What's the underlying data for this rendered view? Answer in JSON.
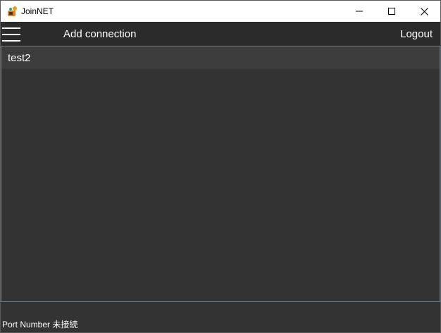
{
  "window": {
    "title": "JoinNET"
  },
  "toolbar": {
    "add_connection_label": "Add connection",
    "logout_label": "Logout"
  },
  "connections": {
    "items": [
      {
        "label": "test2"
      }
    ]
  },
  "status": {
    "text": "Port Number 未接続"
  },
  "colors": {
    "background": "#333333",
    "toolbar": "#2b2b2b",
    "list_item": "#3c3c3c",
    "panel_border": "#6d7c88",
    "text": "#ffffff",
    "titlebar": "#ffffff"
  },
  "icons": {
    "app": "joinnet-app-icon",
    "menu": "hamburger-menu-icon",
    "minimize": "minimize-icon",
    "maximize": "maximize-icon",
    "close": "close-icon"
  }
}
